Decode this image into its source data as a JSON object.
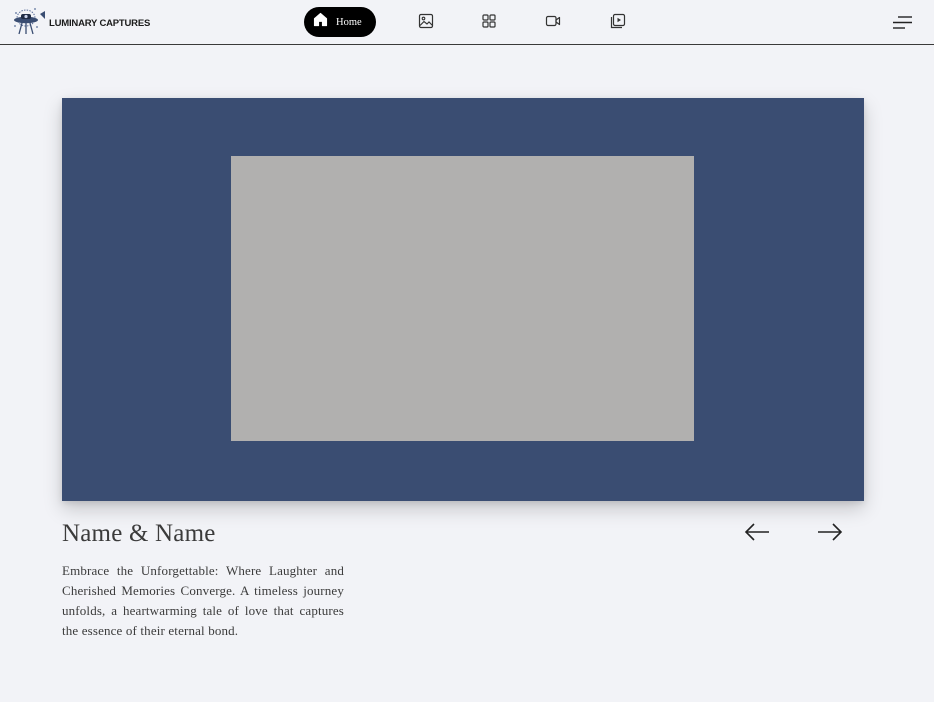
{
  "brand": {
    "name": "LUMINARY CAPTURES",
    "logo_icon": "ufo-camera-logo"
  },
  "nav": {
    "home_label": "Home",
    "icons": [
      "home-icon",
      "image-icon",
      "grid-icon",
      "video-camera-icon",
      "playlist-play-icon",
      "menu-icon"
    ]
  },
  "hero": {
    "background_color": "#3a4d72",
    "photo_placeholder_color": "#b1b0af"
  },
  "caption": {
    "title": "Name & Name",
    "description": "Embrace the Unforgettable: Where Laughter and Cherished Memories Converge. A timeless journey unfolds, a heartwarming tale of love that captures the essence of their eternal bond."
  },
  "controls": {
    "prev_icon": "arrow-left-icon",
    "next_icon": "arrow-right-icon"
  }
}
